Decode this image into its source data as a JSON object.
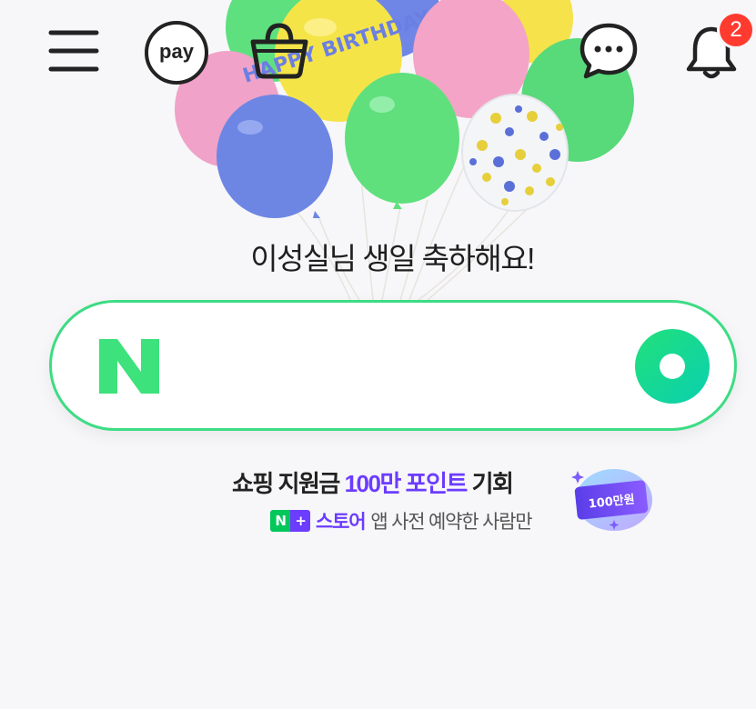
{
  "header": {
    "pay_label": "pay",
    "notification_count": "2",
    "banner_text": "HAPPY BIRTHDAY"
  },
  "greeting": "이성실님 생일 축하해요!",
  "search": {
    "logo": "N",
    "placeholder": ""
  },
  "promo": {
    "line1_prefix": "쇼핑 지원금 ",
    "line1_highlight": "100만 포인트",
    "line1_suffix": " 기회",
    "badge_n": "N",
    "badge_plus": "+",
    "store_label": "스토어",
    "line2_suffix": " 앱 사전 예약한 사람만",
    "coupon_label": "100만원"
  },
  "colors": {
    "accent_green": "#3ddc84",
    "naver_green": "#03c75a",
    "purple": "#6c3cff",
    "badge_red": "#ff3b30"
  },
  "icons": [
    "menu-icon",
    "pay-icon",
    "shopping-bag-icon",
    "chat-icon",
    "bell-icon"
  ]
}
